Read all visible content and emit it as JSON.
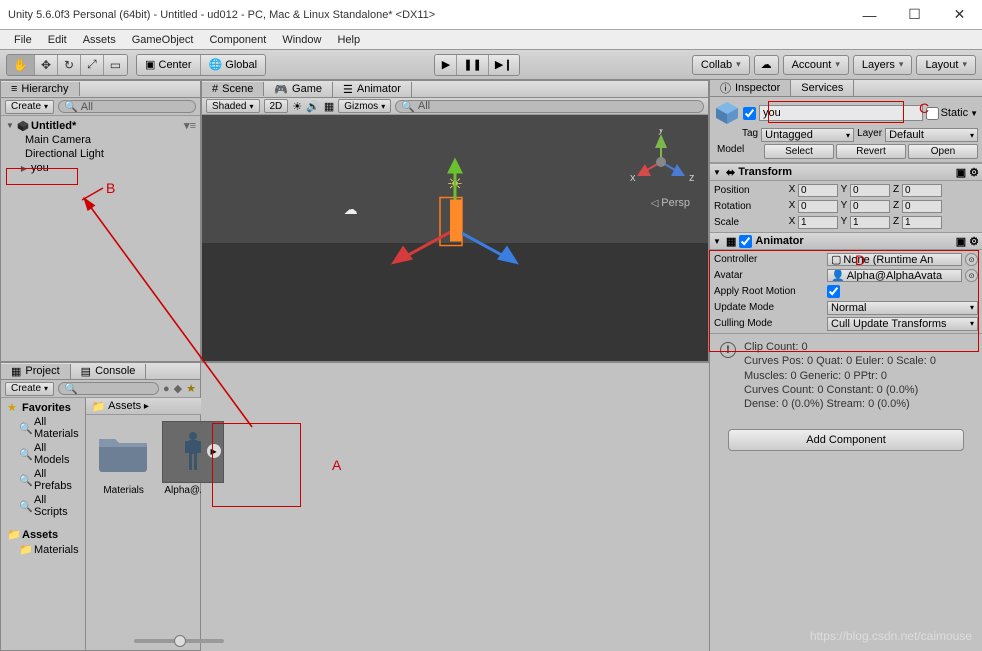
{
  "window": {
    "title": "Unity 5.6.0f3 Personal (64bit) - Untitled - ud012 - PC, Mac & Linux Standalone* <DX11>"
  },
  "menu": [
    "File",
    "Edit",
    "Assets",
    "GameObject",
    "Component",
    "Window",
    "Help"
  ],
  "toolbar": {
    "pivot_center": "Center",
    "pivot_global": "Global",
    "collab": "Collab",
    "account": "Account",
    "layers": "Layers",
    "layout": "Layout"
  },
  "hierarchy": {
    "tab": "Hierarchy",
    "create": "Create",
    "search_placeholder": "All",
    "scene": "Untitled*",
    "items": [
      "Main Camera",
      "Directional Light",
      "you"
    ]
  },
  "scene_tabs": {
    "scene": "Scene",
    "game": "Game",
    "animator": "Animator"
  },
  "scene_toolbar": {
    "shading": "Shaded",
    "mode": "2D",
    "gizmos": "Gizmos",
    "search": "All"
  },
  "viewport": {
    "persp": "Persp",
    "axes": {
      "x": "x",
      "y": "y",
      "z": "z"
    }
  },
  "project": {
    "tab_project": "Project",
    "tab_console": "Console",
    "create": "Create",
    "favorites": "Favorites",
    "fav_items": [
      "All Materials",
      "All Models",
      "All Prefabs",
      "All Scripts"
    ],
    "assets": "Assets",
    "materials": "Materials",
    "breadcrumb": "Assets",
    "items": [
      {
        "name": "Materials",
        "type": "folder"
      },
      {
        "name": "Alpha@Alp...",
        "type": "model"
      }
    ]
  },
  "inspector": {
    "tab_inspector": "Inspector",
    "tab_services": "Services",
    "obj_name": "you",
    "static": "Static",
    "tag_label": "Tag",
    "tag_value": "Untagged",
    "layer_label": "Layer",
    "layer_value": "Default",
    "model_label": "Model",
    "select": "Select",
    "revert": "Revert",
    "open": "Open",
    "transform": {
      "title": "Transform",
      "position": "Position",
      "rotation": "Rotation",
      "scale": "Scale",
      "px": "0",
      "py": "0",
      "pz": "0",
      "rx": "0",
      "ry": "0",
      "rz": "0",
      "sx": "1",
      "sy": "1",
      "sz": "1"
    },
    "animator": {
      "title": "Animator",
      "controller_label": "Controller",
      "controller_value": "None (Runtime An",
      "avatar_label": "Avatar",
      "avatar_value": "Alpha@AlphaAvata",
      "root_motion": "Apply Root Motion",
      "update_mode_label": "Update Mode",
      "update_mode_value": "Normal",
      "culling_label": "Culling Mode",
      "culling_value": "Cull Update Transforms"
    },
    "clip_info": {
      "l1": "Clip Count: 0",
      "l2": "Curves Pos: 0 Quat: 0 Euler: 0 Scale: 0",
      "l3": "Muscles: 0 Generic: 0 PPtr: 0",
      "l4": "Curves Count: 0 Constant: 0 (0.0%)",
      "l5": "Dense: 0 (0.0%) Stream: 0 (0.0%)"
    },
    "add_component": "Add Component"
  },
  "annot": {
    "A": "A",
    "B": "B",
    "C": "C",
    "D": "D"
  },
  "watermark": "https://blog.csdn.net/caimouse"
}
